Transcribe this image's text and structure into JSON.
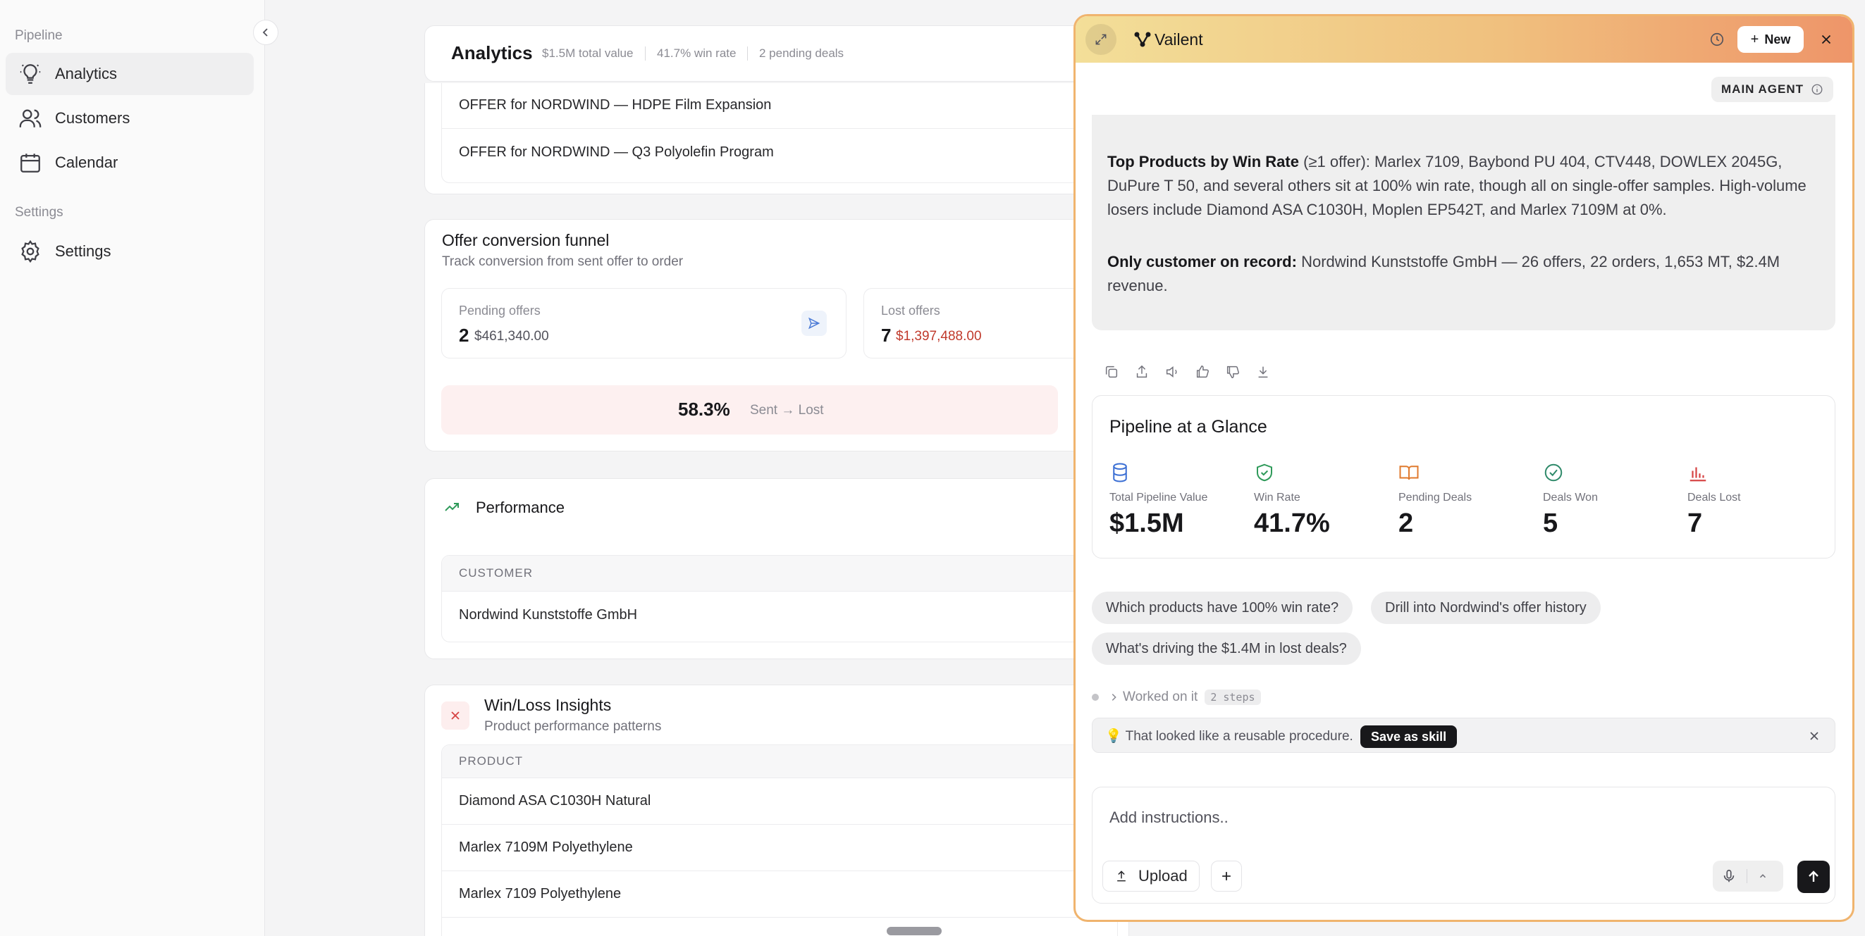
{
  "sidebar": {
    "pipeline_label": "Pipeline",
    "settings_label": "Settings",
    "items": [
      {
        "label": "Analytics",
        "icon": "lightbulb-icon"
      },
      {
        "label": "Customers",
        "icon": "users-icon"
      },
      {
        "label": "Calendar",
        "icon": "calendar-icon"
      },
      {
        "label": "Settings",
        "icon": "gear-icon"
      }
    ]
  },
  "header": {
    "title": "Analytics",
    "total_value": "$1.5M total value",
    "win_rate": "41.7% win rate",
    "pending": "2 pending deals"
  },
  "offers": [
    "OFFER for NORDWIND — HDPE Film Expansion",
    "OFFER for NORDWIND — Q3 Polyolefin Program"
  ],
  "funnel": {
    "title": "Offer conversion funnel",
    "subtitle": "Track conversion from sent offer to order",
    "pending_label": "Pending offers",
    "pending_count": "2",
    "pending_amount": "$461,340.00",
    "lost_label": "Lost offers",
    "lost_count": "7",
    "lost_amount": "$1,397,488.00",
    "rate": "58.3%",
    "rate_label": "Sent → Lost"
  },
  "performance": {
    "title": "Performance",
    "column": "CUSTOMER",
    "rows": [
      "Nordwind Kunststoffe GmbH"
    ]
  },
  "winloss": {
    "title": "Win/Loss Insights",
    "subtitle": "Product performance patterns",
    "column": "PRODUCT",
    "rows": [
      "Diamond ASA C1030H Natural",
      "Marlex 7109M Polyethylene",
      "Marlex 7109 Polyethylene"
    ]
  },
  "panel": {
    "brand": "Vailent",
    "new_label": "New",
    "agent_badge": "MAIN AGENT",
    "message": {
      "p1_bold": "Top Products by Win Rate",
      "p1_text": " (≥1 offer): Marlex 7109, Baybond PU 404, CTV448, DOWLEX 2045G, DuPure T 50, and several others sit at 100% win rate, though all on single-offer samples. High-volume losers include Diamond ASA C1030H, Moplen EP542T, and Marlex 7109M at 0%.",
      "p2_bold": "Only customer on record:",
      "p2_text": " Nordwind Kunststoffe GmbH — 26 offers, 22 orders, 1,653 MT, $2.4M revenue."
    },
    "glance": {
      "title": "Pipeline at a Glance",
      "stats": [
        {
          "label": "Total Pipeline Value",
          "value": "$1.5M",
          "icon": "database-icon",
          "color": "#3b6fd4"
        },
        {
          "label": "Win Rate",
          "value": "41.7%",
          "icon": "shield-check-icon",
          "color": "#2f9a5a"
        },
        {
          "label": "Pending Deals",
          "value": "2",
          "icon": "book-open-icon",
          "color": "#e07a2e"
        },
        {
          "label": "Deals Won",
          "value": "5",
          "icon": "check-circle-icon",
          "color": "#2f8a6a"
        },
        {
          "label": "Deals Lost",
          "value": "7",
          "icon": "bar-chart-icon",
          "color": "#d64545"
        }
      ]
    },
    "chips": [
      "Which products have 100% win rate?",
      "Drill into Nordwind's offer history",
      "What's driving the $1.4M in lost deals?"
    ],
    "worked_on": "Worked on it",
    "steps": "2 steps",
    "skill_text": "💡 That looked like a reusable procedure.",
    "skill_button": "Save as skill",
    "composer_placeholder": "Add instructions..",
    "upload_label": "Upload"
  }
}
